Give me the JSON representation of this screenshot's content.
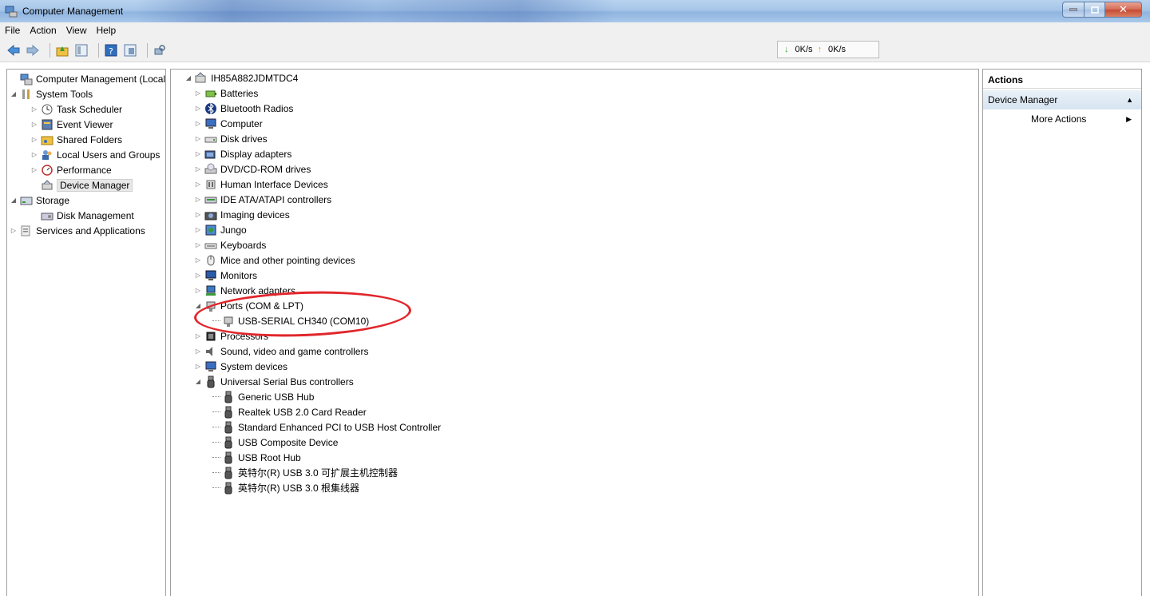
{
  "window": {
    "title": "Computer Management"
  },
  "menu": [
    "File",
    "Action",
    "View",
    "Help"
  ],
  "net_speed": {
    "down": "0K/s",
    "up": "0K/s"
  },
  "left_tree": [
    {
      "label": "Computer Management (Local",
      "level": 0,
      "expander": "",
      "icon": "computer-management-icon"
    },
    {
      "label": "System Tools",
      "level": 1,
      "expander": "expanded",
      "icon": "system-tools-icon"
    },
    {
      "label": "Task Scheduler",
      "level": 2,
      "expander": "collapsed",
      "icon": "clock-icon"
    },
    {
      "label": "Event Viewer",
      "level": 2,
      "expander": "collapsed",
      "icon": "event-viewer-icon"
    },
    {
      "label": "Shared Folders",
      "level": 2,
      "expander": "collapsed",
      "icon": "shared-folder-icon"
    },
    {
      "label": "Local Users and Groups",
      "level": 2,
      "expander": "collapsed",
      "icon": "users-icon"
    },
    {
      "label": "Performance",
      "level": 2,
      "expander": "collapsed",
      "icon": "performance-icon"
    },
    {
      "label": "Device Manager",
      "level": 2,
      "expander": "",
      "icon": "device-manager-icon",
      "selected": true
    },
    {
      "label": "Storage",
      "level": 1,
      "expander": "expanded",
      "icon": "storage-icon"
    },
    {
      "label": "Disk Management",
      "level": 2,
      "expander": "",
      "icon": "disk-management-icon"
    },
    {
      "label": "Services and Applications",
      "level": 1,
      "expander": "collapsed",
      "icon": "services-icon"
    }
  ],
  "device_tree": {
    "root": "IH85A882JDMTDC4",
    "categories": [
      {
        "label": "Batteries",
        "icon": "battery-icon"
      },
      {
        "label": "Bluetooth Radios",
        "icon": "bluetooth-icon"
      },
      {
        "label": "Computer",
        "icon": "computer-icon"
      },
      {
        "label": "Disk drives",
        "icon": "disk-drive-icon"
      },
      {
        "label": "Display adapters",
        "icon": "display-adapter-icon"
      },
      {
        "label": "DVD/CD-ROM drives",
        "icon": "dvd-icon"
      },
      {
        "label": "Human Interface Devices",
        "icon": "hid-icon"
      },
      {
        "label": "IDE ATA/ATAPI controllers",
        "icon": "ide-icon"
      },
      {
        "label": "Imaging devices",
        "icon": "camera-icon"
      },
      {
        "label": "Jungo",
        "icon": "jungo-icon"
      },
      {
        "label": "Keyboards",
        "icon": "keyboard-icon"
      },
      {
        "label": "Mice and other pointing devices",
        "icon": "mouse-icon"
      },
      {
        "label": "Monitors",
        "icon": "monitor-icon"
      },
      {
        "label": "Network adapters",
        "icon": "network-icon"
      },
      {
        "label": "Ports (COM & LPT)",
        "icon": "port-icon",
        "expanded": true,
        "children": [
          "USB-SERIAL CH340 (COM10)"
        ]
      },
      {
        "label": "Processors",
        "icon": "processor-icon"
      },
      {
        "label": "Sound, video and game controllers",
        "icon": "sound-icon"
      },
      {
        "label": "System devices",
        "icon": "system-devices-icon"
      },
      {
        "label": "Universal Serial Bus controllers",
        "icon": "usb-icon",
        "expanded": true,
        "children": [
          "Generic USB Hub",
          "Realtek USB 2.0 Card Reader",
          "Standard Enhanced PCI to USB Host Controller",
          "USB Composite Device",
          "USB Root Hub",
          "英特尔(R) USB 3.0 可扩展主机控制器",
          "英特尔(R) USB 3.0 根集线器"
        ]
      }
    ]
  },
  "actions": {
    "header": "Actions",
    "section": "Device Manager",
    "items": [
      "More Actions"
    ]
  },
  "colors": {
    "annotation_ring": "#e1262b",
    "titlebar": "#a6c5e8",
    "close_button": "#c44a32"
  }
}
